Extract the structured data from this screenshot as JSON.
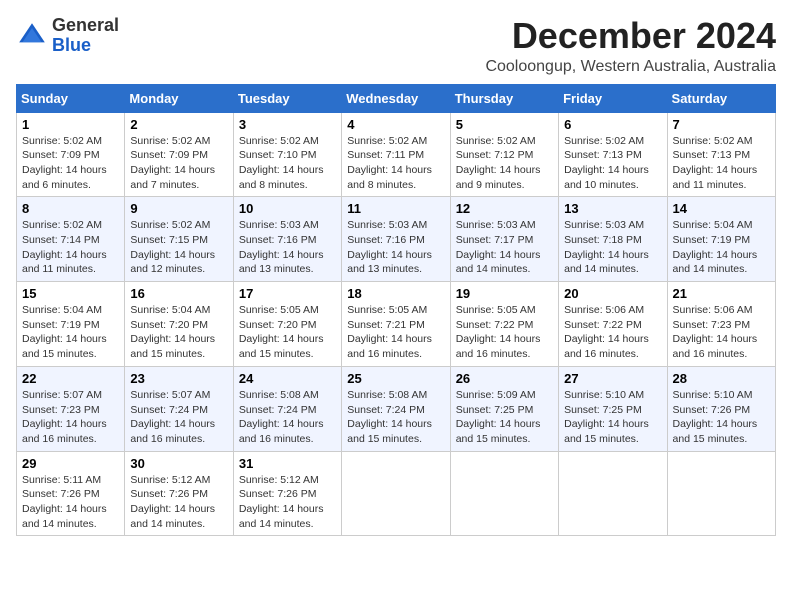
{
  "header": {
    "logo_general": "General",
    "logo_blue": "Blue",
    "title": "December 2024",
    "location": "Cooloongup, Western Australia, Australia"
  },
  "days_of_week": [
    "Sunday",
    "Monday",
    "Tuesday",
    "Wednesday",
    "Thursday",
    "Friday",
    "Saturday"
  ],
  "weeks": [
    [
      {
        "day": "1",
        "sunrise": "5:02 AM",
        "sunset": "7:09 PM",
        "daylight": "14 hours and 6 minutes."
      },
      {
        "day": "2",
        "sunrise": "5:02 AM",
        "sunset": "7:09 PM",
        "daylight": "14 hours and 7 minutes."
      },
      {
        "day": "3",
        "sunrise": "5:02 AM",
        "sunset": "7:10 PM",
        "daylight": "14 hours and 8 minutes."
      },
      {
        "day": "4",
        "sunrise": "5:02 AM",
        "sunset": "7:11 PM",
        "daylight": "14 hours and 8 minutes."
      },
      {
        "day": "5",
        "sunrise": "5:02 AM",
        "sunset": "7:12 PM",
        "daylight": "14 hours and 9 minutes."
      },
      {
        "day": "6",
        "sunrise": "5:02 AM",
        "sunset": "7:13 PM",
        "daylight": "14 hours and 10 minutes."
      },
      {
        "day": "7",
        "sunrise": "5:02 AM",
        "sunset": "7:13 PM",
        "daylight": "14 hours and 11 minutes."
      }
    ],
    [
      {
        "day": "8",
        "sunrise": "5:02 AM",
        "sunset": "7:14 PM",
        "daylight": "14 hours and 11 minutes."
      },
      {
        "day": "9",
        "sunrise": "5:02 AM",
        "sunset": "7:15 PM",
        "daylight": "14 hours and 12 minutes."
      },
      {
        "day": "10",
        "sunrise": "5:03 AM",
        "sunset": "7:16 PM",
        "daylight": "14 hours and 13 minutes."
      },
      {
        "day": "11",
        "sunrise": "5:03 AM",
        "sunset": "7:16 PM",
        "daylight": "14 hours and 13 minutes."
      },
      {
        "day": "12",
        "sunrise": "5:03 AM",
        "sunset": "7:17 PM",
        "daylight": "14 hours and 14 minutes."
      },
      {
        "day": "13",
        "sunrise": "5:03 AM",
        "sunset": "7:18 PM",
        "daylight": "14 hours and 14 minutes."
      },
      {
        "day": "14",
        "sunrise": "5:04 AM",
        "sunset": "7:19 PM",
        "daylight": "14 hours and 14 minutes."
      }
    ],
    [
      {
        "day": "15",
        "sunrise": "5:04 AM",
        "sunset": "7:19 PM",
        "daylight": "14 hours and 15 minutes."
      },
      {
        "day": "16",
        "sunrise": "5:04 AM",
        "sunset": "7:20 PM",
        "daylight": "14 hours and 15 minutes."
      },
      {
        "day": "17",
        "sunrise": "5:05 AM",
        "sunset": "7:20 PM",
        "daylight": "14 hours and 15 minutes."
      },
      {
        "day": "18",
        "sunrise": "5:05 AM",
        "sunset": "7:21 PM",
        "daylight": "14 hours and 16 minutes."
      },
      {
        "day": "19",
        "sunrise": "5:05 AM",
        "sunset": "7:22 PM",
        "daylight": "14 hours and 16 minutes."
      },
      {
        "day": "20",
        "sunrise": "5:06 AM",
        "sunset": "7:22 PM",
        "daylight": "14 hours and 16 minutes."
      },
      {
        "day": "21",
        "sunrise": "5:06 AM",
        "sunset": "7:23 PM",
        "daylight": "14 hours and 16 minutes."
      }
    ],
    [
      {
        "day": "22",
        "sunrise": "5:07 AM",
        "sunset": "7:23 PM",
        "daylight": "14 hours and 16 minutes."
      },
      {
        "day": "23",
        "sunrise": "5:07 AM",
        "sunset": "7:24 PM",
        "daylight": "14 hours and 16 minutes."
      },
      {
        "day": "24",
        "sunrise": "5:08 AM",
        "sunset": "7:24 PM",
        "daylight": "14 hours and 16 minutes."
      },
      {
        "day": "25",
        "sunrise": "5:08 AM",
        "sunset": "7:24 PM",
        "daylight": "14 hours and 15 minutes."
      },
      {
        "day": "26",
        "sunrise": "5:09 AM",
        "sunset": "7:25 PM",
        "daylight": "14 hours and 15 minutes."
      },
      {
        "day": "27",
        "sunrise": "5:10 AM",
        "sunset": "7:25 PM",
        "daylight": "14 hours and 15 minutes."
      },
      {
        "day": "28",
        "sunrise": "5:10 AM",
        "sunset": "7:26 PM",
        "daylight": "14 hours and 15 minutes."
      }
    ],
    [
      {
        "day": "29",
        "sunrise": "5:11 AM",
        "sunset": "7:26 PM",
        "daylight": "14 hours and 14 minutes."
      },
      {
        "day": "30",
        "sunrise": "5:12 AM",
        "sunset": "7:26 PM",
        "daylight": "14 hours and 14 minutes."
      },
      {
        "day": "31",
        "sunrise": "5:12 AM",
        "sunset": "7:26 PM",
        "daylight": "14 hours and 14 minutes."
      },
      null,
      null,
      null,
      null
    ]
  ],
  "labels": {
    "sunrise": "Sunrise:",
    "sunset": "Sunset:",
    "daylight": "Daylight:"
  }
}
